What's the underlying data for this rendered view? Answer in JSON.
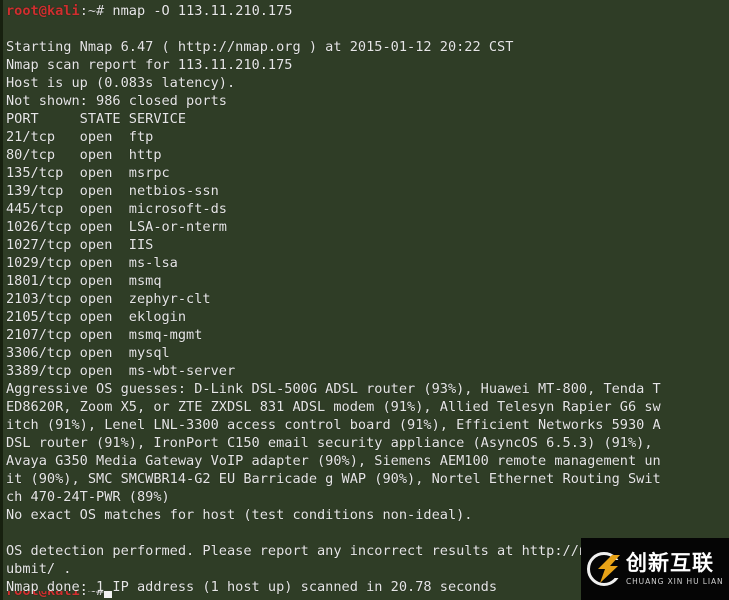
{
  "terminal": {
    "background_color": "#2f3d26",
    "foreground_color": "#e6e6e6",
    "prompt_color": "#cf2f2f",
    "prompt": {
      "user": "root",
      "at": "@",
      "host": "kali",
      "separator": ":",
      "path": "~#",
      "command": " nmap -O 113.11.210.175"
    },
    "lines": [
      "",
      "Starting Nmap 6.47 ( http://nmap.org ) at 2015-01-12 20:22 CST",
      "Nmap scan report for 113.11.210.175",
      "Host is up (0.083s latency).",
      "Not shown: 986 closed ports",
      "PORT     STATE SERVICE",
      "21/tcp   open  ftp",
      "80/tcp   open  http",
      "135/tcp  open  msrpc",
      "139/tcp  open  netbios-ssn",
      "445/tcp  open  microsoft-ds",
      "1026/tcp open  LSA-or-nterm",
      "1027/tcp open  IIS",
      "1029/tcp open  ms-lsa",
      "1801/tcp open  msmq",
      "2103/tcp open  zephyr-clt",
      "2105/tcp open  eklogin",
      "2107/tcp open  msmq-mgmt",
      "3306/tcp open  mysql",
      "3389/tcp open  ms-wbt-server",
      "Aggressive OS guesses: D-Link DSL-500G ADSL router (93%), Huawei MT-800, Tenda T",
      "ED8620R, Zoom X5, or ZTE ZXDSL 831 ADSL modem (91%), Allied Telesyn Rapier G6 sw",
      "itch (91%), Lenel LNL-3300 access control board (91%), Efficient Networks 5930 A",
      "DSL router (91%), IronPort C150 email security appliance (AsyncOS 6.5.3) (91%),",
      "Avaya G350 Media Gateway VoIP adapter (90%), Siemens AEM100 remote management un",
      "it (90%), SMC SMCWBR14-G2 EU Barricade g WAP (90%), Nortel Ethernet Routing Swit",
      "ch 470-24T-PWR (89%)",
      "No exact OS matches for host (test conditions non-ideal).",
      "",
      "OS detection performed. Please report any incorrect results at http://nmap.org/s",
      "ubmit/ .",
      "Nmap done: 1 IP address (1 host up) scanned in 20.78 seconds"
    ]
  },
  "watermark": {
    "chinese_text": "创新互联",
    "pinyin_text": "CHUANG XIN HU LIAN",
    "background_color": "#050505",
    "accent_color": "#e8a317"
  }
}
